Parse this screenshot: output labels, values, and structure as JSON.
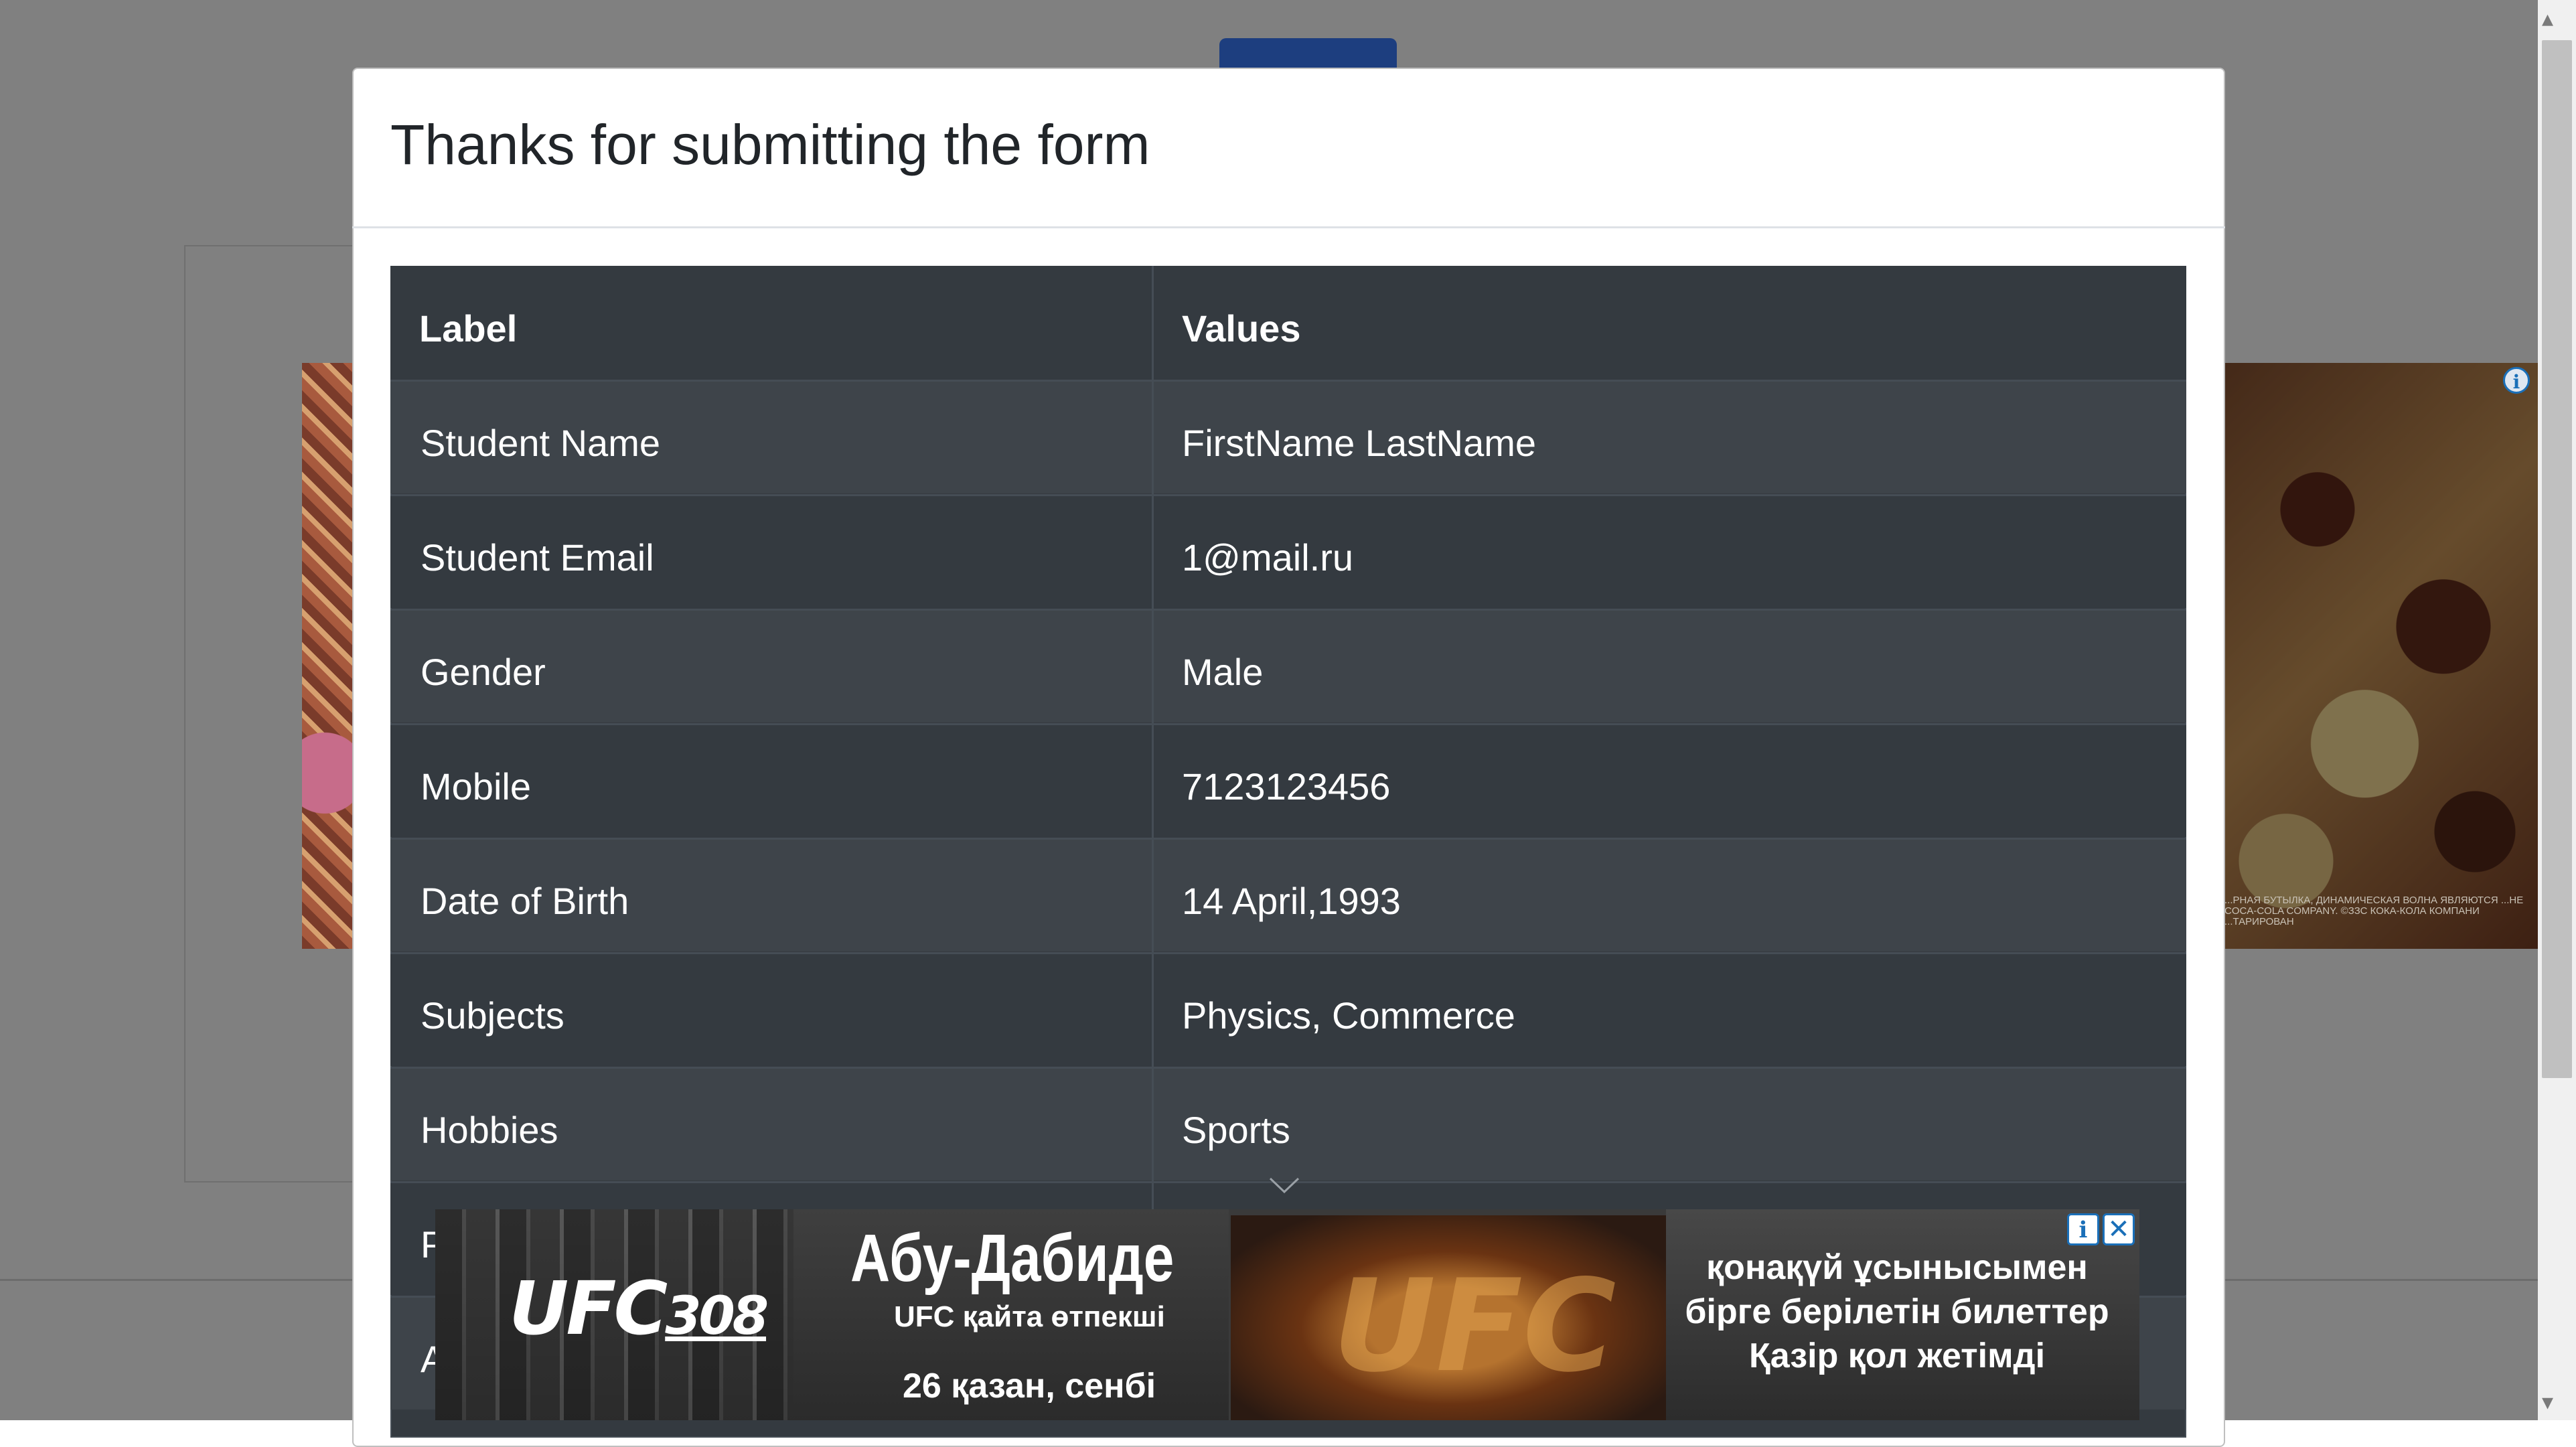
{
  "modal": {
    "title": "Thanks for submitting the form"
  },
  "table": {
    "headers": {
      "label": "Label",
      "values": "Values"
    },
    "rows": [
      {
        "label": "Student Name",
        "value": "FirstName LastName"
      },
      {
        "label": "Student Email",
        "value": "1@mail.ru"
      },
      {
        "label": "Gender",
        "value": "Male"
      },
      {
        "label": "Mobile",
        "value": "7123123456"
      },
      {
        "label": "Date of Birth",
        "value": "14 April,1993"
      },
      {
        "label": "Subjects",
        "value": "Physics, Commerce"
      },
      {
        "label": "Hobbies",
        "value": "Sports"
      },
      {
        "label": "P",
        "value": ""
      },
      {
        "label": "A",
        "value": ""
      }
    ]
  },
  "ad_bottom": {
    "logo": "UFC",
    "logo_number": "308",
    "headline": "Абу-Дабиде",
    "subline": "UFC қайта өтпекші",
    "date": "26 қазан, сенбі",
    "belt_text": "UFC",
    "offer_lines": [
      "қонақүй ұсынысымен",
      "бірге берілетін билеттер",
      "Қазір қол жетімді"
    ],
    "info_icon": "info-icon",
    "close_icon": "close-icon"
  },
  "ad_right": {
    "info_icon": "info-icon",
    "disclaimer": "...РНАЯ БУТЫЛКА, ДИНАМИЧЕСКАЯ ВОЛНА ЯВЛЯЮТСЯ ...НЕ COCA-COLA COMPANY. ©ЗЗС КОКА-КОЛА КОМПАНИ ...ТАРИРОВАН"
  },
  "colors": {
    "backdrop": "#808080",
    "table_dark": "#343a40",
    "table_stripe": "#3e444a",
    "table_border": "#454d55",
    "title_text": "#212529",
    "bg_button": "#1d3e7f"
  }
}
